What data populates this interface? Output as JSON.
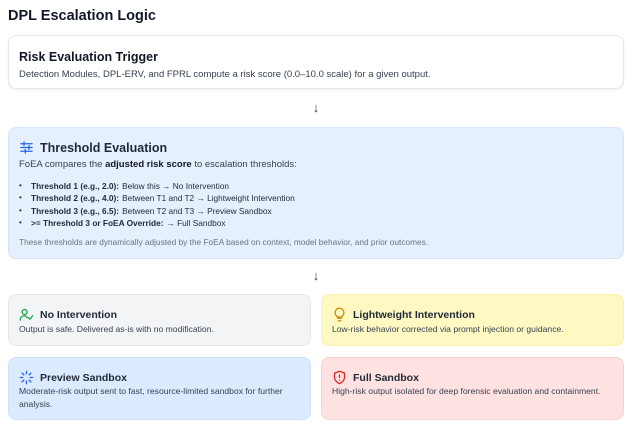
{
  "page_title": "DPL Escalation Logic",
  "trigger": {
    "title": "Risk Evaluation Trigger",
    "description": "Detection Modules, DPL-ERV, and FPRL compute a risk score (0.0–10.0 scale) for a given output."
  },
  "arrow_glyph": "↓",
  "threshold": {
    "icon": "sliders-icon",
    "title": "Threshold Evaluation",
    "intro_prefix": "FoEA compares the ",
    "intro_bold": "adjusted risk score",
    "intro_suffix": " to escalation thresholds:",
    "items": [
      {
        "label": "Threshold 1 (e.g., 2.0):",
        "text": "Below this → No Intervention"
      },
      {
        "label": "Threshold 2 (e.g., 4.0):",
        "text": "Between T1 and T2 → Lightweight Intervention"
      },
      {
        "label": "Threshold 3 (e.g., 6.5):",
        "text": "Between T2 and T3 → Preview Sandbox"
      },
      {
        "label": ">= Threshold 3 or FoEA Override:",
        "text": "→ Full Sandbox"
      }
    ],
    "note": "These thresholds are dynamically adjusted by the FoEA based on context, model behavior, and prior outcomes."
  },
  "outcomes": {
    "none": {
      "icon": "user-check-icon",
      "title": "No Intervention",
      "description": "Output is safe. Delivered as-is with no modification.",
      "color": "#16a34a"
    },
    "light": {
      "icon": "lightbulb-icon",
      "title": "Lightweight Intervention",
      "description": "Low-risk behavior corrected via prompt injection or guidance.",
      "color": "#ca8a04"
    },
    "preview": {
      "icon": "loader-icon",
      "title": "Preview Sandbox",
      "description": "Moderate-risk output sent to fast, resource-limited sandbox for further analysis.",
      "color": "#2563eb"
    },
    "full": {
      "icon": "shield-alert-icon",
      "title": "Full Sandbox",
      "description": "High-risk output isolated for deep forensic evaluation and containment.",
      "color": "#dc2626"
    }
  }
}
